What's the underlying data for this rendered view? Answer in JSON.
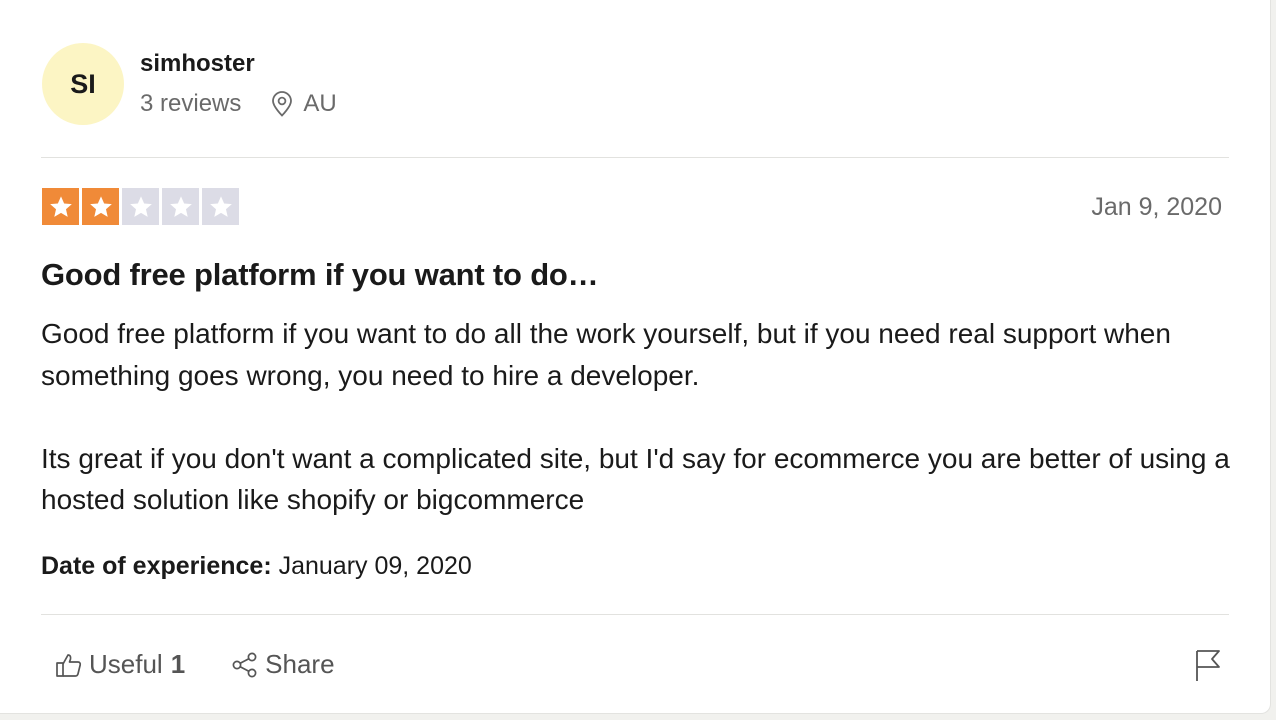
{
  "reviewer": {
    "initials": "SI",
    "name": "simhoster",
    "reviews_count": "3 reviews",
    "location": "AU",
    "location_icon": "location-pin-icon",
    "avatar_color": "#fcf5c4"
  },
  "review": {
    "rating": 2,
    "rating_max": 5,
    "star_filled_color": "#f08a38",
    "star_empty_color": "#dcdce6",
    "date": "Jan 9, 2020",
    "title": "Good free platform if you want to do…",
    "paragraphs": [
      "Good free platform if you want to do all the work yourself, but if you need real support when something goes wrong, you need to hire a developer.",
      "Its great if you don't want a complicated site, but I'd say for ecommerce you are better of using a hosted solution like shopify or bigcommerce"
    ],
    "experience_label": "Date of experience:",
    "experience_date": "January 09, 2020"
  },
  "actions": {
    "useful_label": "Useful",
    "useful_count": "1",
    "useful_icon": "thumbs-up-icon",
    "share_label": "Share",
    "share_icon": "share-icon",
    "report_icon": "flag-icon"
  }
}
